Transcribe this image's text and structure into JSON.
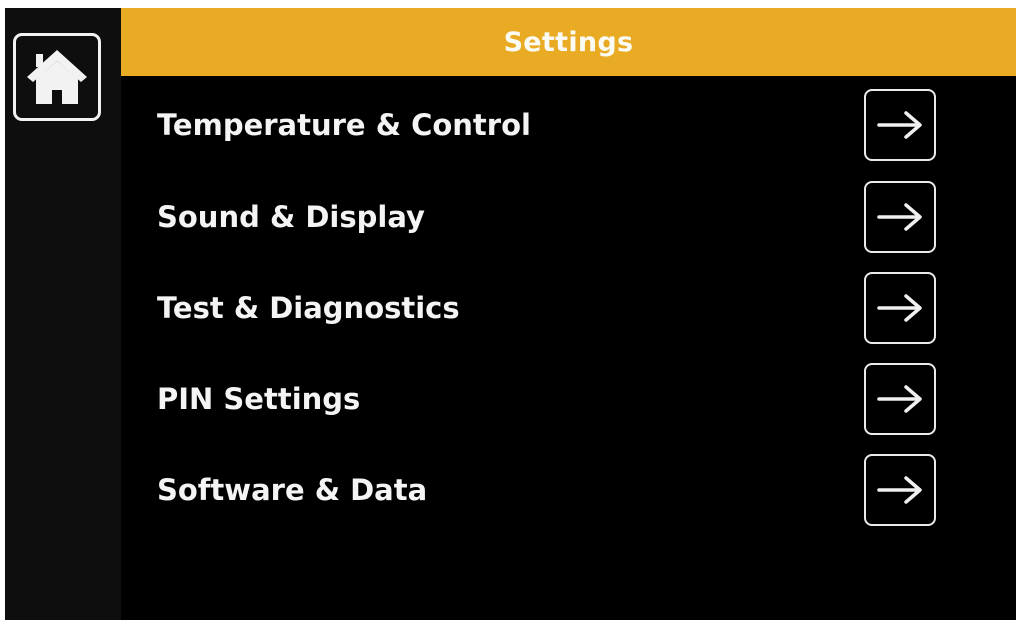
{
  "sidebar": {
    "home_icon": "home-icon"
  },
  "header": {
    "title": "Settings"
  },
  "menu": {
    "items": [
      {
        "label": "Temperature & Control",
        "icon": "arrow-right-icon"
      },
      {
        "label": "Sound & Display",
        "icon": "arrow-right-icon"
      },
      {
        "label": "Test & Diagnostics",
        "icon": "arrow-right-icon"
      },
      {
        "label": "PIN Settings",
        "icon": "arrow-right-icon"
      },
      {
        "label": "Software & Data",
        "icon": "arrow-right-icon"
      }
    ]
  },
  "colors": {
    "header_background": "#e9ab24",
    "screen_background": "#000000",
    "text": "#f4f4f4"
  }
}
